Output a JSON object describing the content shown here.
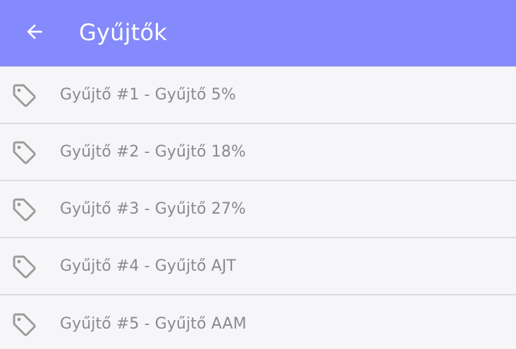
{
  "toolbar": {
    "title": "Gyűjtők",
    "back_icon": "arrow-left-icon",
    "background": "#8489fb"
  },
  "list": {
    "item_icon": "tag-icon",
    "items": [
      {
        "label": "Gyűjtő #1 - Gyűjtő 5%"
      },
      {
        "label": "Gyűjtő #2 - Gyűjtő 18%"
      },
      {
        "label": "Gyűjtő #3 - Gyűjtő 27%"
      },
      {
        "label": "Gyűjtő #4 - Gyűjtő AJT"
      },
      {
        "label": "Gyűjtő #5 - Gyűjtő AAM"
      }
    ]
  }
}
